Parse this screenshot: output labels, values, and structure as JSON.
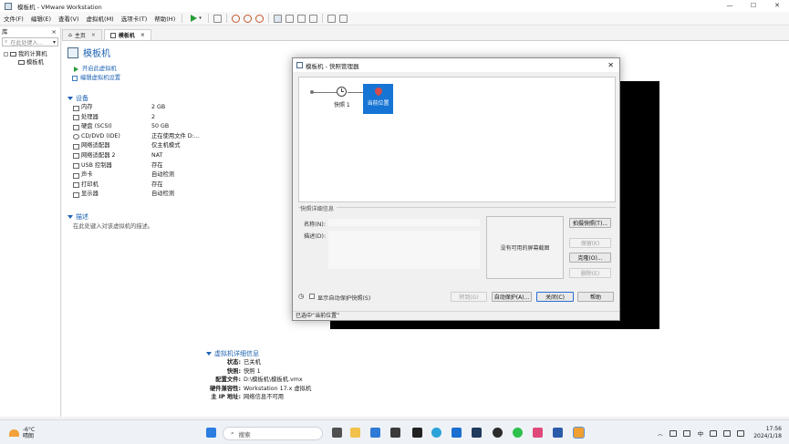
{
  "window": {
    "title": "模板机 - VMware Workstation"
  },
  "menu": [
    "文件(F)",
    "编辑(E)",
    "查看(V)",
    "虚拟机(M)",
    "选项卡(T)",
    "帮助(H)"
  ],
  "library": {
    "title": "库",
    "close": "×",
    "search_placeholder": "在此处键入...",
    "tree": [
      "我的计算机",
      "模板机"
    ]
  },
  "tabs": [
    {
      "label": "主页",
      "close": "×"
    },
    {
      "label": "模板机",
      "close": "×"
    }
  ],
  "vm": {
    "name": "模板机",
    "actions": [
      "开启此虚拟机",
      "编辑虚拟机设置"
    ],
    "devices_header": "设备",
    "devices": [
      {
        "name": "内存",
        "value": "2 GB",
        "icon": "memory-icon"
      },
      {
        "name": "处理器",
        "value": "2",
        "icon": "cpu-icon"
      },
      {
        "name": "硬盘 (SCSI)",
        "value": "50 GB",
        "icon": "disk-icon"
      },
      {
        "name": "CD/DVD (IDE)",
        "value": "正在使用文件 D:...",
        "icon": "cd-icon"
      },
      {
        "name": "网络适配器",
        "value": "仅主机模式",
        "icon": "network-icon"
      },
      {
        "name": "网络适配器 2",
        "value": "NAT",
        "icon": "network-icon"
      },
      {
        "name": "USB 控制器",
        "value": "存在",
        "icon": "usb-icon"
      },
      {
        "name": "声卡",
        "value": "自动检测",
        "icon": "sound-icon"
      },
      {
        "name": "打印机",
        "value": "存在",
        "icon": "printer-icon"
      },
      {
        "name": "显示器",
        "value": "自动检测",
        "icon": "monitor-icon"
      }
    ],
    "description_header": "描述",
    "description_placeholder": "在此处键入对该虚拟机的描述。",
    "details_header": "虚拟机详细信息",
    "details": [
      {
        "k": "状态:",
        "v": "已关机"
      },
      {
        "k": "快照:",
        "v": "快照 1"
      },
      {
        "k": "配置文件:",
        "v": "D:\\模板机\\模板机.vmx"
      },
      {
        "k": "硬件兼容性:",
        "v": "Workstation 17.x 虚拟机"
      },
      {
        "k": "主 IP 地址:",
        "v": "网络信息不可用"
      }
    ]
  },
  "dialog": {
    "title": "模板机 - 快照管理器",
    "close": "✕",
    "snapshot_name": "快照 1",
    "current_label": "当前位置",
    "details_legend": "快照详细信息",
    "name_label": "名称(N):",
    "desc_label": "描述(D):",
    "no_screenshot": "没有可用的屏幕截图",
    "buttons": {
      "take": "拍摄快照(T)...",
      "keep": "保留(K)",
      "clone": "克隆(O)...",
      "delete": "删除(E)",
      "goto": "转到(G)",
      "autoprotect": "自动保护(A)...",
      "close": "关闭(C)",
      "help": "帮助"
    },
    "show_autoprotect": "显示自动保护快照(S)",
    "status": "已选中“当前位置”"
  },
  "taskbar": {
    "weather_temp": "-6°C",
    "weather_desc": "晴朗",
    "search_placeholder": "搜索",
    "ime": "中",
    "time": "17:56",
    "date": "2024/1/18"
  }
}
